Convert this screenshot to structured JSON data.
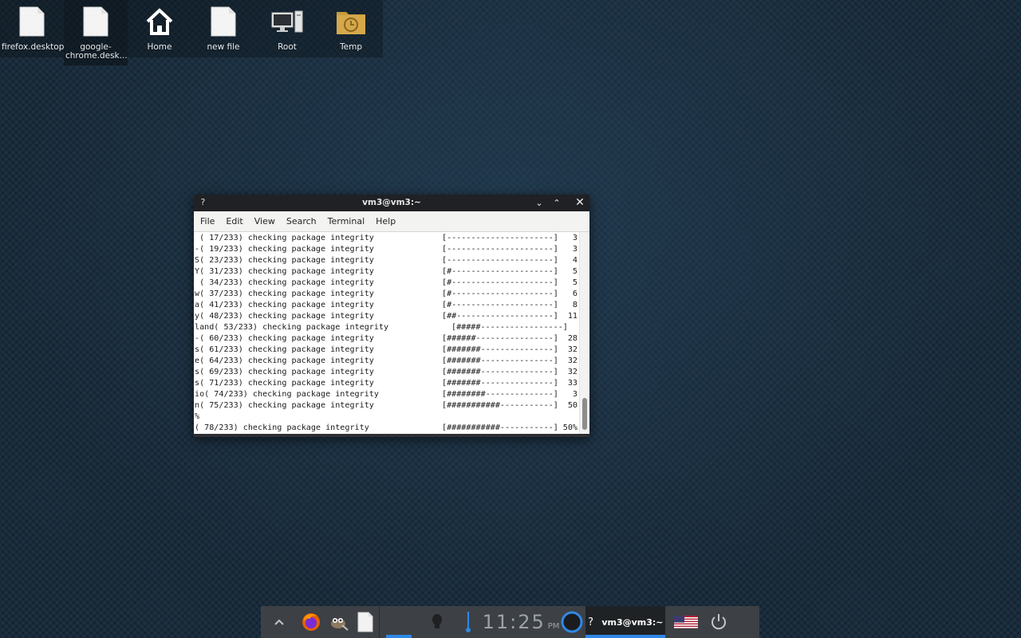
{
  "desktop": {
    "icons": [
      {
        "label": "firefox.desktop"
      },
      {
        "label": "google-chrome.desk..."
      },
      {
        "label": "Home"
      },
      {
        "label": "new file"
      },
      {
        "label": "Root"
      },
      {
        "label": "Temp"
      }
    ]
  },
  "window": {
    "app_icon": "?",
    "title": "vm3@vm3:~",
    "controls": {
      "minimize": "⌄",
      "maximize": "⌃",
      "close": "✕"
    }
  },
  "menu": [
    "File",
    "Edit",
    "View",
    "Search",
    "Terminal",
    "Help"
  ],
  "terminal": {
    "lines": [
      {
        "msg": " ( 17/233) checking package integrity",
        "bar": "[----------------------]",
        "pct": "3"
      },
      {
        "msg": "-( 19/233) checking package integrity",
        "bar": "[----------------------]",
        "pct": "3"
      },
      {
        "msg": "S( 23/233) checking package integrity",
        "bar": "[----------------------]",
        "pct": "4"
      },
      {
        "msg": "Y( 31/233) checking package integrity",
        "bar": "[#---------------------]",
        "pct": "5"
      },
      {
        "msg": " ( 34/233) checking package integrity",
        "bar": "[#---------------------]",
        "pct": "5"
      },
      {
        "msg": "w( 37/233) checking package integrity",
        "bar": "[#---------------------]",
        "pct": "6"
      },
      {
        "msg": "a( 41/233) checking package integrity",
        "bar": "[#---------------------]",
        "pct": "8"
      },
      {
        "msg": "y( 48/233) checking package integrity",
        "bar": "[##--------------------]",
        "pct": "11"
      },
      {
        "msg": "land( 53/233) checking package integrity",
        "bar": "[#####-----------------]",
        "pct": ""
      },
      {
        "msg": "-( 60/233) checking package integrity",
        "bar": "[######----------------]",
        "pct": "28"
      },
      {
        "msg": "s( 61/233) checking package integrity",
        "bar": "[#######---------------]",
        "pct": "32"
      },
      {
        "msg": "e( 64/233) checking package integrity",
        "bar": "[#######---------------]",
        "pct": "32"
      },
      {
        "msg": "s( 69/233) checking package integrity",
        "bar": "[#######---------------]",
        "pct": "32"
      },
      {
        "msg": "s( 71/233) checking package integrity",
        "bar": "[#######---------------]",
        "pct": "33"
      },
      {
        "msg": "io( 74/233) checking package integrity",
        "bar": "[########--------------]",
        "pct": "3"
      },
      {
        "msg": "n( 75/233) checking package integrity",
        "bar": "[###########-----------]",
        "pct": "50"
      },
      {
        "msg": "%",
        "bar": "",
        "pct": ""
      },
      {
        "msg": "( 78/233) checking package integrity",
        "bar": "[###########-----------]",
        "pct": "50%"
      }
    ]
  },
  "taskbar": {
    "clock": {
      "time": "11:25",
      "ampm": "PM"
    },
    "active_task": {
      "icon": "?",
      "label": "vm3@vm3:~"
    }
  }
}
